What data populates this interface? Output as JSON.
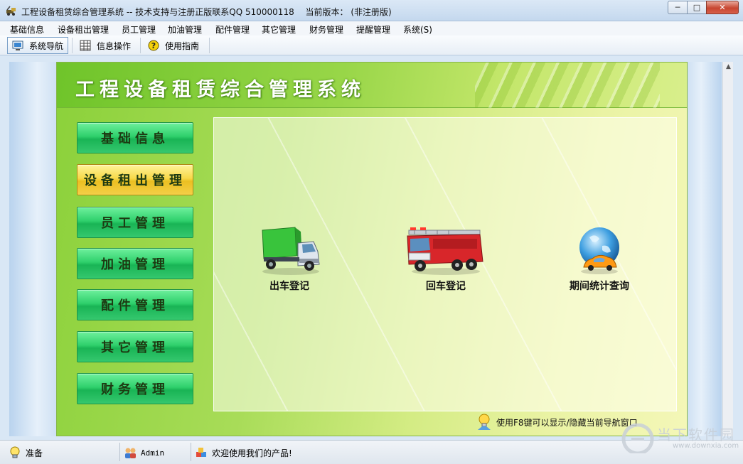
{
  "window": {
    "title": "工程设备租赁综合管理系统 -- 技术支持与注册正版联系QQ 510000118　 当前版本： (非注册版)",
    "controls": [
      "minimize-icon",
      "maximize-icon",
      "close-icon"
    ]
  },
  "menubar": {
    "items": [
      "基础信息",
      "设备租出管理",
      "员工管理",
      "加油管理",
      "配件管理",
      "其它管理",
      "财务管理",
      "提醒管理",
      "系统(S)"
    ]
  },
  "toolbar": {
    "items": [
      {
        "label": "系统导航",
        "icon": "monitor-icon",
        "active": true
      },
      {
        "label": "信息操作",
        "icon": "grid-icon",
        "active": false
      },
      {
        "label": "使用指南",
        "icon": "help-icon",
        "active": false
      }
    ]
  },
  "panel": {
    "title": "工程设备租赁综合管理系统",
    "nav": [
      {
        "label": "基础信息",
        "selected": false
      },
      {
        "label": "设备租出管理",
        "selected": true
      },
      {
        "label": "员工管理",
        "selected": false
      },
      {
        "label": "加油管理",
        "selected": false
      },
      {
        "label": "配件管理",
        "selected": false
      },
      {
        "label": "其它管理",
        "selected": false
      },
      {
        "label": "财务管理",
        "selected": false
      }
    ],
    "tiles": [
      {
        "label": "出车登记",
        "icon": "green-truck-icon"
      },
      {
        "label": "回车登记",
        "icon": "fire-truck-icon"
      },
      {
        "label": "期间统计查询",
        "icon": "globe-car-icon"
      }
    ],
    "hint": "使用F8键可以显示/隐藏当前导航窗口"
  },
  "statusbar": {
    "ready": "准备",
    "user": "Admin",
    "message": "欢迎使用我们的产品!"
  },
  "watermark": {
    "text": "当下软件园",
    "url": "www.downxia.com"
  },
  "colors": {
    "nav_green": "#2fd06c",
    "nav_selected": "#f7d94a",
    "panel_green": "#a8dc58"
  }
}
